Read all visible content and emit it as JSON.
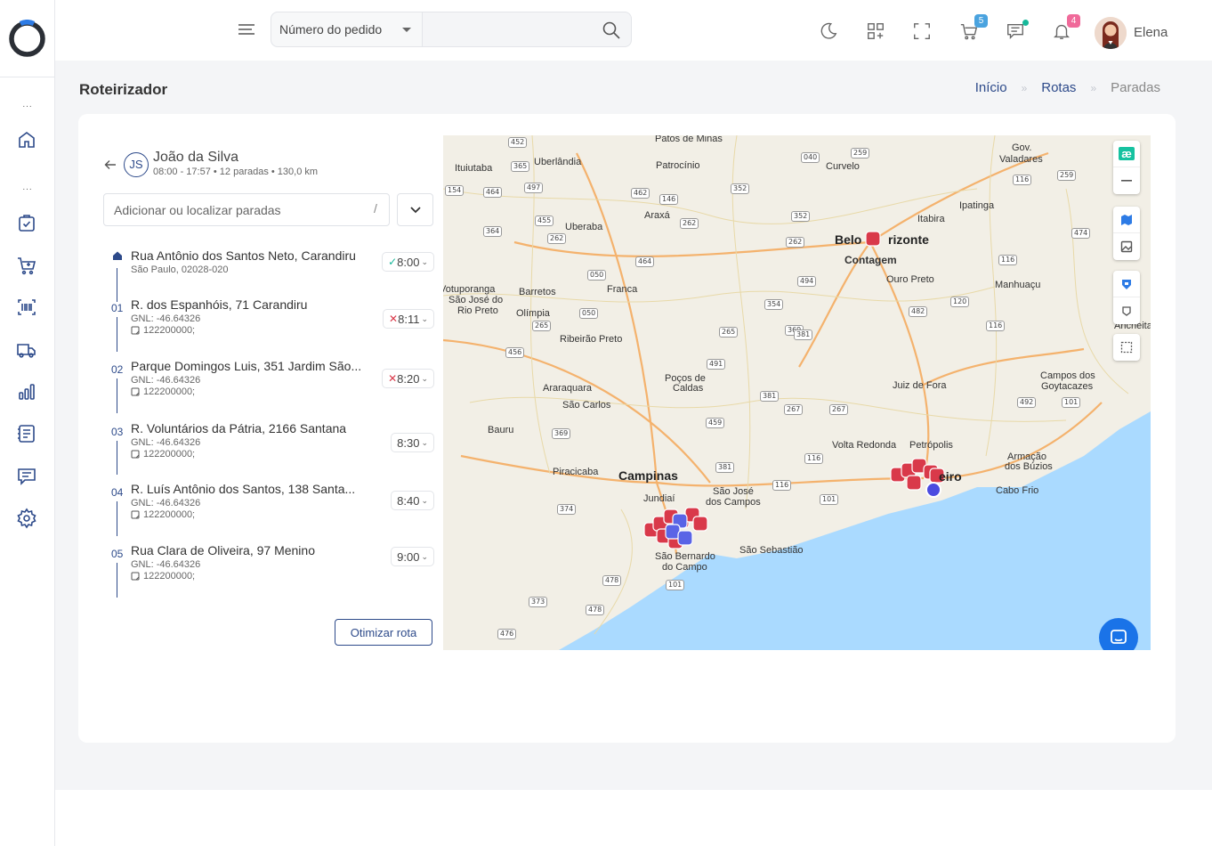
{
  "sidebar": {
    "items": [
      {
        "icon": "home-icon"
      },
      {
        "icon": "clipboard-check-icon"
      },
      {
        "icon": "cart-add-icon"
      },
      {
        "icon": "barcode-icon"
      },
      {
        "icon": "truck-icon"
      },
      {
        "icon": "bar-chart-icon"
      },
      {
        "icon": "document-list-icon"
      },
      {
        "icon": "chat-icon"
      },
      {
        "icon": "gear-icon"
      }
    ],
    "dots": "..."
  },
  "topbar": {
    "search_select": "Número do pedido",
    "search_placeholder": "",
    "cart_badge": "5",
    "notification_badge": "4",
    "user_name": "Elena"
  },
  "page": {
    "title": "Roteirizador",
    "breadcrumb": [
      "Início",
      "Rotas",
      "Paradas"
    ],
    "breadcrumb_sep": "»"
  },
  "driver": {
    "initials": "JS",
    "name": "João da Silva",
    "meta": "08:00 - 17:57  •  12 paradas  •  130,0 km"
  },
  "stop_search": {
    "placeholder": "Adicionar ou localizar paradas",
    "hint": "/"
  },
  "stops": [
    {
      "num": "",
      "address": "Rua Antônio dos Santos Neto, Carandiru",
      "sub": "São Paulo, 02028-020",
      "sub2": "",
      "time": "8:00",
      "status": "ok"
    },
    {
      "num": "01",
      "address": "R. dos Espanhóis, 71 Carandiru",
      "sub": "GNL: -46.64326",
      "sub2": "122200000;",
      "time": "8:11",
      "status": "late"
    },
    {
      "num": "02",
      "address": "Parque Domingos Luis, 351 Jardim São...",
      "sub": "GNL: -46.64326",
      "sub2": "122200000;",
      "time": "8:20",
      "status": "late"
    },
    {
      "num": "03",
      "address": "R. Voluntários da Pátria, 2166 Santana",
      "sub": "GNL: -46.64326",
      "sub2": "122200000;",
      "time": "8:30",
      "status": ""
    },
    {
      "num": "04",
      "address": "R. Luís Antônio dos Santos, 138 Santa...",
      "sub": "GNL: -46.64326",
      "sub2": "122200000;",
      "time": "8:40",
      "status": ""
    },
    {
      "num": "05",
      "address": "Rua Clara de Oliveira, 97 Menino",
      "sub": "GNL: -46.64326",
      "sub2": "122200000;",
      "time": "9:00",
      "status": ""
    }
  ],
  "optimize_label": "Otimizar rota",
  "map": {
    "cities": [
      {
        "name": "Patos de Minas",
        "cls": ""
      },
      {
        "name": "Uberlândia",
        "cls": ""
      },
      {
        "name": "Patrocínio",
        "cls": ""
      },
      {
        "name": "Curvelo",
        "cls": ""
      },
      {
        "name": "Gov.",
        "cls": ""
      },
      {
        "name": "Valadares",
        "cls": ""
      },
      {
        "name": "Ituiutaba",
        "cls": ""
      },
      {
        "name": "Uberaba",
        "cls": ""
      },
      {
        "name": "Araxá",
        "cls": ""
      },
      {
        "name": "Itabira",
        "cls": ""
      },
      {
        "name": "Ipatinga",
        "cls": ""
      },
      {
        "name": "Belo",
        "cls": "big"
      },
      {
        "name": "rizonte",
        "cls": "big"
      },
      {
        "name": "Contagem",
        "cls": "med"
      },
      {
        "name": "Franca",
        "cls": ""
      },
      {
        "name": "Barretos",
        "cls": ""
      },
      {
        "name": "Votuporanga",
        "cls": ""
      },
      {
        "name": "São José do",
        "cls": ""
      },
      {
        "name": "Rio Preto",
        "cls": ""
      },
      {
        "name": "Olímpia",
        "cls": ""
      },
      {
        "name": "Ouro Preto",
        "cls": ""
      },
      {
        "name": "Manhuaçu",
        "cls": ""
      },
      {
        "name": "Ribeirão Preto",
        "cls": ""
      },
      {
        "name": "Araraquara",
        "cls": ""
      },
      {
        "name": "São Carlos",
        "cls": ""
      },
      {
        "name": "Poços de",
        "cls": ""
      },
      {
        "name": "Caldas",
        "cls": ""
      },
      {
        "name": "Juiz de Fora",
        "cls": ""
      },
      {
        "name": "Campos dos",
        "cls": ""
      },
      {
        "name": "Goytacazes",
        "cls": ""
      },
      {
        "name": "Bauru",
        "cls": ""
      },
      {
        "name": "Volta Redonda",
        "cls": ""
      },
      {
        "name": "Petrópolis",
        "cls": ""
      },
      {
        "name": "Piracicaba",
        "cls": ""
      },
      {
        "name": "Campinas",
        "cls": "big"
      },
      {
        "name": "Jundiaí",
        "cls": ""
      },
      {
        "name": "São José",
        "cls": ""
      },
      {
        "name": "dos Campos",
        "cls": ""
      },
      {
        "name": "eiro",
        "cls": "big"
      },
      {
        "name": "Cabo Frio",
        "cls": ""
      },
      {
        "name": "Armação",
        "cls": ""
      },
      {
        "name": "dos Búzios",
        "cls": ""
      },
      {
        "name": "São Bernardo",
        "cls": ""
      },
      {
        "name": "do Campo",
        "cls": ""
      },
      {
        "name": "São Sebastião",
        "cls": ""
      },
      {
        "name": "Ancheita",
        "cls": ""
      }
    ],
    "road_badges": [
      "452",
      "365",
      "040",
      "259",
      "154",
      "464",
      "497",
      "462",
      "146",
      "352",
      "116",
      "259",
      "364",
      "455",
      "262",
      "262",
      "352",
      "262",
      "116",
      "474",
      "050",
      "464",
      "494",
      "482",
      "120",
      "050",
      "265",
      "354",
      "369",
      "381",
      "116",
      "456",
      "491",
      "265",
      "381",
      "267",
      "267",
      "492",
      "101",
      "369",
      "459",
      "116",
      "381",
      "374",
      "101",
      "116",
      "478",
      "101",
      "373",
      "478",
      "476"
    ],
    "brand_badge": "æ"
  },
  "colors": {
    "primary": "#2d4a8a",
    "accent_teal": "#16b89a",
    "badge_blue": "#4aa3df",
    "badge_pink": "#f06a9a",
    "marker_red": "#d9394a",
    "marker_blue": "#5a64e6",
    "map_water": "#aadaff",
    "map_land": "#f2efe6"
  }
}
